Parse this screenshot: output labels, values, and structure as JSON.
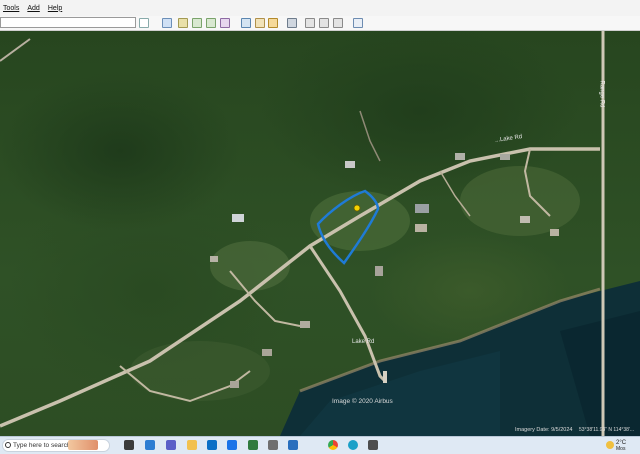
{
  "menu": {
    "items": [
      "Tools",
      "Add",
      "Help"
    ]
  },
  "toolbar": {
    "search_value": ""
  },
  "map": {
    "attribution": "Image © 2020 Airbus",
    "imagery_date": "Imagery Date: 9/5/2024",
    "coordinates": "53°38'11.93\" N 114°38'...",
    "road_label_top": "...Lake Rd",
    "road_label_right": "Range Rd",
    "road_label_bottom": "Lake Rd",
    "colors": {
      "water": "#0f2f3a",
      "forest": "#2b4a26",
      "road": "#c9c1ad",
      "boundary": "#1f7bd6",
      "pin": "#f5d200"
    }
  },
  "taskbar": {
    "search_placeholder": "Type here to search",
    "temperature": "2°C",
    "weather_text": "Mos",
    "apps": [
      "widgets-icon",
      "task-view-icon",
      "teams-icon",
      "file-explorer-icon",
      "store-icon",
      "mail-icon",
      "calendar-icon",
      "chrome-icon",
      "edge-icon",
      "earth-icon"
    ]
  }
}
